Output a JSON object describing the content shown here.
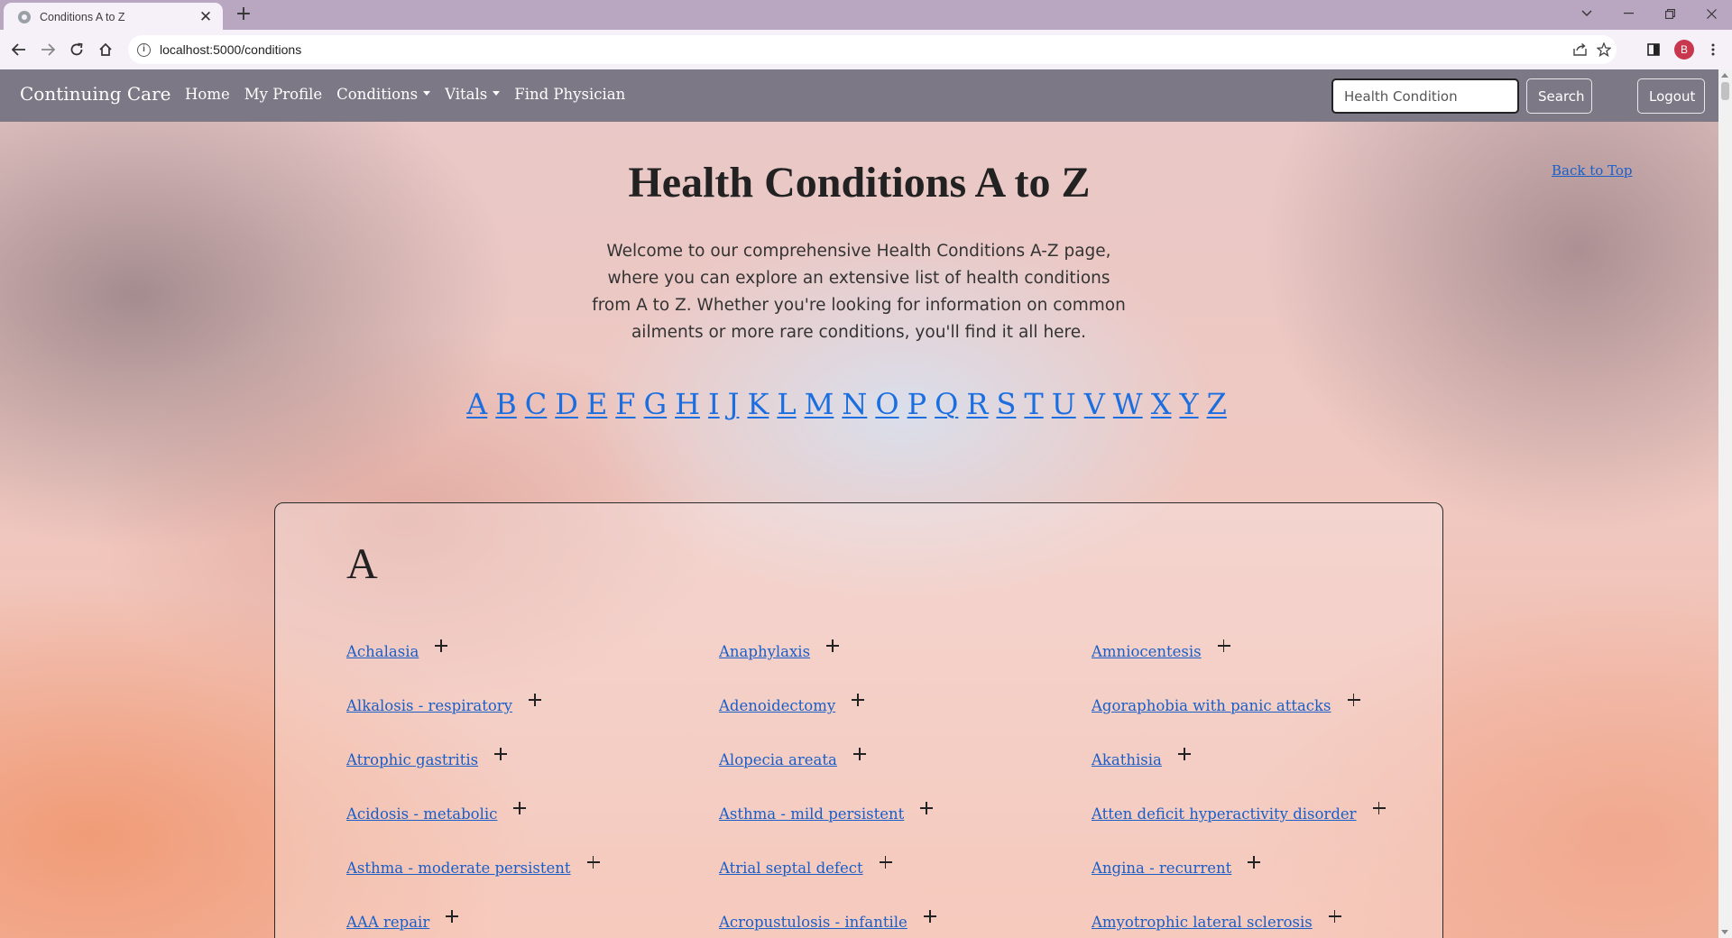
{
  "browser": {
    "tab_title": "Conditions A to Z",
    "url": "localhost:5000/conditions",
    "profile_initial": "B"
  },
  "navbar": {
    "brand": "Continuing Care",
    "links": [
      "Home",
      "My Profile",
      "Conditions",
      "Vitals",
      "Find Physician"
    ],
    "search_placeholder": "Health Condition",
    "search_button": "Search",
    "logout_button": "Logout"
  },
  "page": {
    "title": "Health Conditions A to Z",
    "back_to_top": "Back to Top",
    "intro": "Welcome to our comprehensive Health Conditions A-Z page, where you can explore an extensive list of health conditions from A to Z. Whether you're looking for information on common ailments or more rare conditions, you'll find it all here.",
    "alphabet": [
      "A",
      "B",
      "C",
      "D",
      "E",
      "F",
      "G",
      "H",
      "I",
      "J",
      "K",
      "L",
      "M",
      "N",
      "O",
      "P",
      "Q",
      "R",
      "S",
      "T",
      "U",
      "V",
      "W",
      "X",
      "Y",
      "Z"
    ]
  },
  "section": {
    "letter": "A",
    "conditions": [
      "Achalasia",
      "Anaphylaxis",
      "Amniocentesis",
      "Alkalosis - respiratory",
      "Adenoidectomy",
      "Agoraphobia with panic attacks",
      "Atrophic gastritis",
      "Alopecia areata",
      "Akathisia",
      "Acidosis - metabolic",
      "Asthma - mild persistent",
      "Atten deficit hyperactivity disorder",
      "Asthma - moderate persistent",
      "Atrial septal defect",
      "Angina - recurrent",
      "AAA repair",
      "Acropustulosis - infantile",
      "Amyotrophic lateral sclerosis"
    ]
  }
}
